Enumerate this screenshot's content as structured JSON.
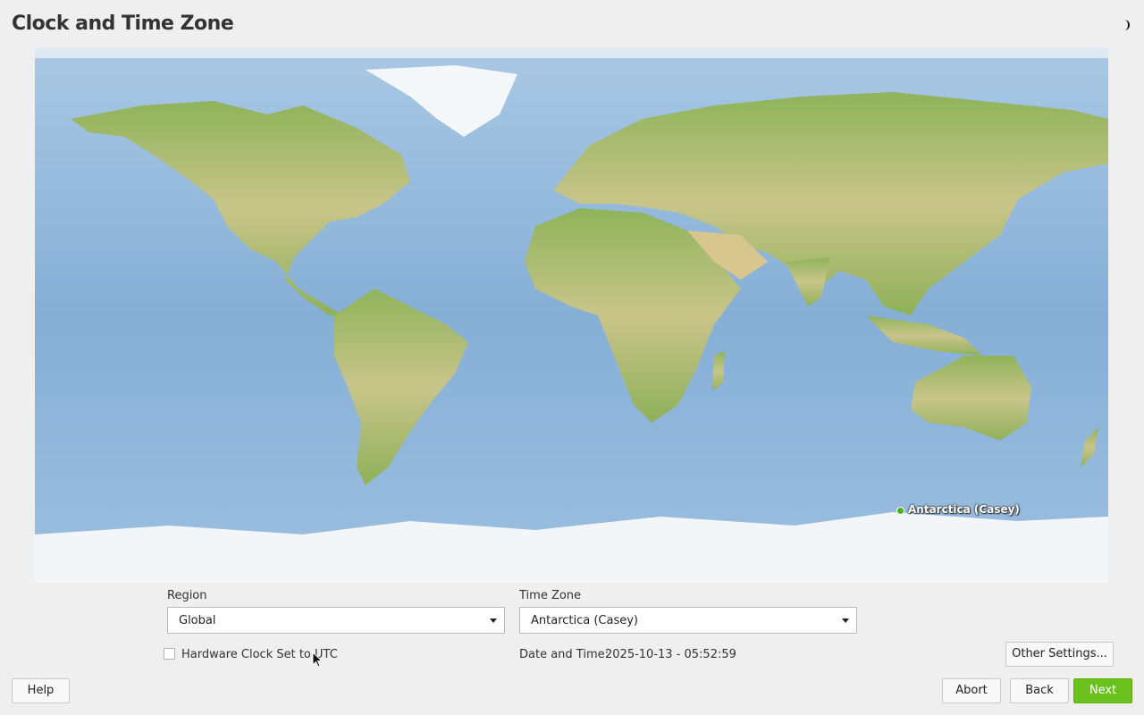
{
  "header": {
    "title": "Clock and Time Zone",
    "theme_icon": "half-moon-icon"
  },
  "map": {
    "selected_marker_label": "Antarctica (Casey)",
    "marker_color": "#4caf1a",
    "ocean_color": "#8fb6d9",
    "land_color": "#a7bf6a"
  },
  "region": {
    "label": "Region",
    "value": "Global"
  },
  "timezone": {
    "label": "Time Zone",
    "value": "Antarctica (Casey)"
  },
  "hardware_clock": {
    "label": "Hardware Clock Set to UTC",
    "checked": false
  },
  "datetime": {
    "label": "Date and Time:",
    "value": "2025-10-13 - 05:52:59"
  },
  "buttons": {
    "other_settings": "Other Settings...",
    "help": "Help",
    "abort": "Abort",
    "back": "Back",
    "next": "Next"
  },
  "colors": {
    "accent": "#6ac11e",
    "background": "#efefef"
  }
}
